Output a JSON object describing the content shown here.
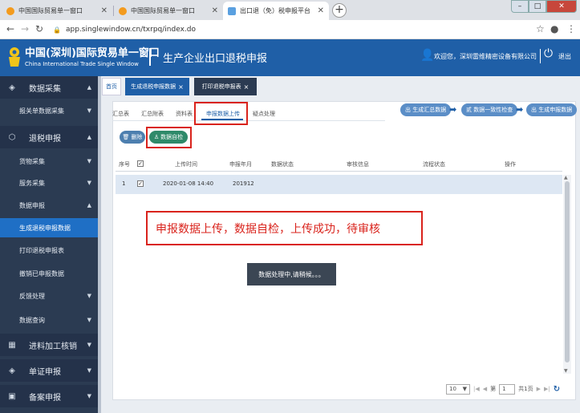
{
  "browser": {
    "tabs": [
      {
        "title": "中国国际贸易单一窗口"
      },
      {
        "title": "中国国际贸易单一窗口"
      },
      {
        "title": "出口退（免）税申报平台"
      }
    ],
    "url": "app.singlewindow.cn/txrpq/index.do",
    "new_tab": "+",
    "win_min": "–",
    "win_max": "□",
    "win_close": "✕"
  },
  "header": {
    "site_name": "中国(深圳)国际贸易单一窗口",
    "site_sub": "China International Trade Single Window",
    "system_title": "生产企业出口退税申报",
    "welcome": "欢迎您，深圳雷维精密设备有限公司",
    "logout": "退出"
  },
  "sidebar": {
    "items": [
      {
        "label": "数据采集",
        "icon": "layers-icon",
        "glyph": "◈",
        "arrow": "▲",
        "level": "top"
      },
      {
        "label": "报关单数据采集",
        "arrow": "▼",
        "level": "sub"
      },
      {
        "label": "退税申报",
        "icon": "cube-icon",
        "glyph": "⬡",
        "arrow": "▲",
        "level": "top"
      },
      {
        "label": "货物采集",
        "arrow": "▼",
        "level": "sub"
      },
      {
        "label": "服务采集",
        "arrow": "▼",
        "level": "sub"
      },
      {
        "label": "数据申报",
        "arrow": "▲",
        "level": "sub"
      },
      {
        "label": "生成退税申报数据",
        "arrow": "",
        "level": "sub",
        "selected": true
      },
      {
        "label": "打印退税申报表",
        "arrow": "",
        "level": "sub"
      },
      {
        "label": "撤销已申报数据",
        "arrow": "",
        "level": "sub"
      },
      {
        "label": "反馈处理",
        "arrow": "▼",
        "level": "sub"
      },
      {
        "label": "数据查询",
        "arrow": "▼",
        "level": "sub"
      },
      {
        "label": "进料加工核销",
        "icon": "grid-icon",
        "glyph": "▦",
        "arrow": "▼",
        "level": "top"
      },
      {
        "label": "单证申报",
        "icon": "layers-icon",
        "glyph": "◈",
        "arrow": "▼",
        "level": "top"
      },
      {
        "label": "备案申报",
        "icon": "briefcase-icon",
        "glyph": "▣",
        "arrow": "▼",
        "level": "top"
      }
    ]
  },
  "content_tabs": [
    {
      "label": "首页",
      "close": ""
    },
    {
      "label": "生成退税申报数据",
      "close": "×"
    },
    {
      "label": "打印退税申报表",
      "close": "×"
    }
  ],
  "sub_tabs": [
    "汇总表",
    "汇总附表",
    "资料表",
    "申报数据上传",
    "疑点处理"
  ],
  "flow": {
    "steps": [
      "生成汇总数据",
      "数据一致性检查",
      "生成申报数据"
    ],
    "icons": [
      "出",
      "贰",
      "出"
    ],
    "arrow": "➡"
  },
  "actions": {
    "delete_label": "删除",
    "check_label": "数据自检"
  },
  "table": {
    "headers": [
      "序号",
      "上传时间",
      "申报年月",
      "数据状态",
      "审核信息",
      "流程状态",
      "操作"
    ],
    "rows": [
      {
        "index": "1",
        "upload_time": "2020-01-08 14:40",
        "period": "201912",
        "data_status": "",
        "audit": "",
        "flow_status": "",
        "ops": ""
      }
    ],
    "check": "✓"
  },
  "annotation": "申报数据上传，数据自检，上传成功，待审核",
  "loading_text": "数据处理中,请稍候。。。",
  "pager": {
    "page_size": "10",
    "prefix": "第",
    "page": "1",
    "total": "共1页"
  }
}
